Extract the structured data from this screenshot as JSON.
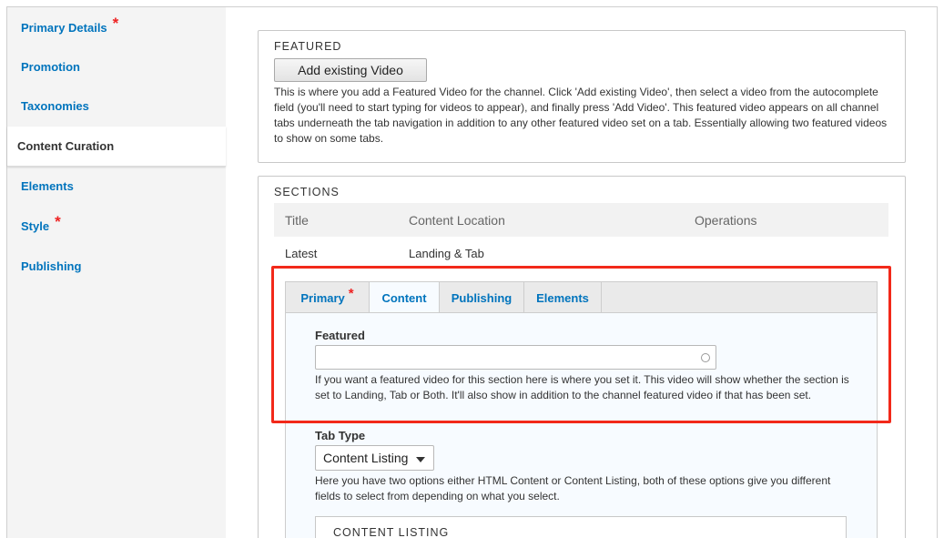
{
  "sidebar": {
    "items": [
      {
        "label": "Primary Details",
        "required": "*"
      },
      {
        "label": "Promotion"
      },
      {
        "label": "Taxonomies"
      },
      {
        "label": "Content Curation",
        "active": true
      },
      {
        "label": "Elements"
      },
      {
        "label": "Style",
        "required": "*"
      },
      {
        "label": "Publishing"
      }
    ]
  },
  "featured": {
    "legend": "FEATURED",
    "button_label": "Add existing Video",
    "description": "This is where you add a Featured Video for the channel. Click 'Add existing Video', then select a video from the autocomplete field (you'll need to start typing for videos to appear), and finally press 'Add Video'. This featured video appears on all channel tabs underneath the tab navigation in addition to any other featured video set on a tab. Essentially allowing two featured videos to show on some tabs."
  },
  "sections": {
    "legend": "SECTIONS",
    "columns": [
      "Title",
      "Content Location",
      "Operations"
    ],
    "rows": [
      {
        "title": "Latest",
        "location": "Landing & Tab"
      }
    ]
  },
  "tabs": {
    "items": [
      {
        "label": "Primary",
        "required": "*"
      },
      {
        "label": "Content",
        "active": true
      },
      {
        "label": "Publishing"
      },
      {
        "label": "Elements"
      }
    ]
  },
  "content_tab": {
    "featured_label": "Featured",
    "featured_value": "",
    "featured_description": "If you want a featured video for this section here is where you set it. This video will show whether the section is set to Landing, Tab or Both. It'll also show in addition to the channel featured video if that has been set.",
    "tab_type_label": "Tab Type",
    "tab_type_value": "Content Listing",
    "tab_type_description": "Here you have two options either HTML Content or Content Listing, both of these options give you different fields to select from depending on what you select.",
    "content_listing_legend": "CONTENT LISTING"
  },
  "colors": {
    "link": "#0074bd",
    "required": "#ee2222",
    "highlight": "#f2291a",
    "tab_panel_bg": "#f7fbff"
  }
}
